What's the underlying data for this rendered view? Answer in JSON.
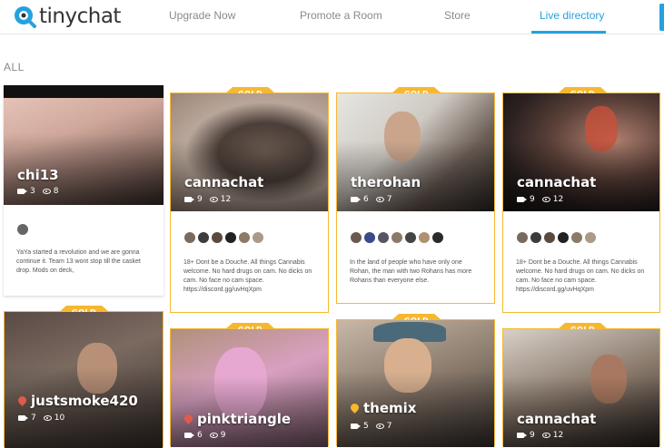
{
  "app": {
    "name": "tinychat"
  },
  "nav": {
    "upgrade": "Upgrade Now",
    "promote": "Promote a Room",
    "store": "Store",
    "live": "Live directory"
  },
  "section": {
    "label": "ALL"
  },
  "gold_label": "GOLD",
  "colors": {
    "accent": "#25a2dc",
    "gold": "#f6b830"
  },
  "rooms": [
    {
      "name": "chi13",
      "cams": "3",
      "viewers": "8",
      "gold": false,
      "desc": "YaYa started a revolution and we are gonna continue it. Team 13 wont stop till the casket drop. Mods on deck,"
    },
    {
      "name": "cannachat",
      "cams": "9",
      "viewers": "12",
      "gold": true,
      "desc": "18+ Dont be a Douche. All things Cannabis welcome. No hard drugs on cam. No dicks on cam. No face no cam space. https://discord.gg/uvHqXpm"
    },
    {
      "name": "therohan",
      "cams": "6",
      "viewers": "7",
      "gold": true,
      "desc": "In the land of people who have only one Rohan, the man with two Rohans has more Rohans than everyone else."
    },
    {
      "name": "cannachat",
      "cams": "9",
      "viewers": "12",
      "gold": true,
      "desc": "18+ Dont be a Douche. All things Cannabis welcome. No hard drugs on cam. No dicks on cam. No face no cam space. https://discord.gg/uvHqXpm"
    },
    {
      "name": "justsmoke420",
      "cams": "7",
      "viewers": "10",
      "gold": true,
      "pin": "red"
    },
    {
      "name": "pinktriangle",
      "cams": "6",
      "viewers": "9",
      "gold": true,
      "pin": "red"
    },
    {
      "name": "themix",
      "cams": "5",
      "viewers": "7",
      "gold": true,
      "pin": "yellow"
    },
    {
      "name": "cannachat",
      "cams": "9",
      "viewers": "12",
      "gold": true
    }
  ]
}
